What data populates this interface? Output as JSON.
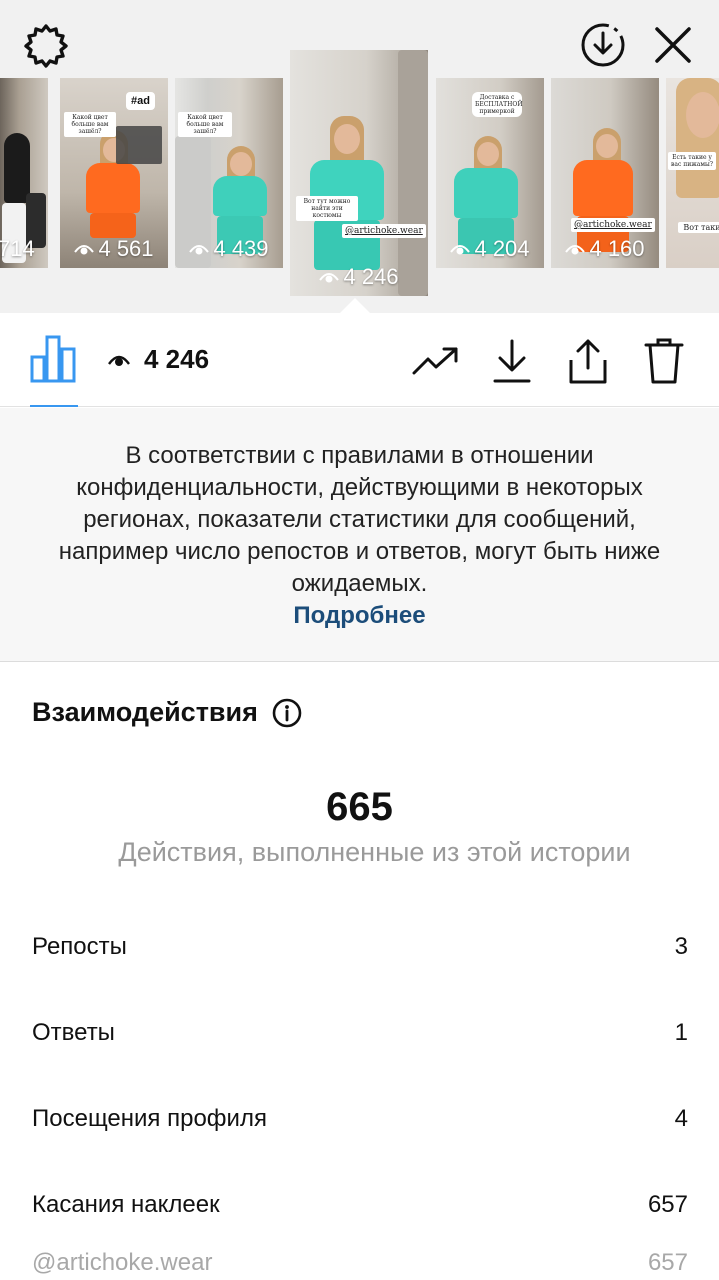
{
  "stories": [
    {
      "views": "714"
    },
    {
      "views": "4 561",
      "tag": "#ad",
      "note": "Какой цвет больше вам зашёл?"
    },
    {
      "views": "4 439",
      "note": "Какой цвет больше вам зашёл?"
    },
    {
      "views": "4 246",
      "note": "Вот тут можно найти эти костюмы",
      "mention": "@artichoke.wear"
    },
    {
      "views": "4 204",
      "note": "Доставка с БЕСПЛАТНОЙ примеркой"
    },
    {
      "views": "4 160",
      "mention": "@artichoke.wear"
    },
    {
      "note": "Есть такие у вас пижамы?",
      "note2": "Вот таки"
    }
  ],
  "action_bar": {
    "views": "4 246"
  },
  "notice": {
    "text": "В соответствии с правилами в отношении конфиденциальности, действующими в некоторых регионах, показатели статистики для сообщений, например число репостов и ответов, могут быть ниже ожидаемых.",
    "link": "Подробнее"
  },
  "interactions": {
    "title": "Взаимодействия",
    "total": "665",
    "caption": "Действия, выполненные из этой истории",
    "rows": [
      {
        "label": "Репосты",
        "value": "3"
      },
      {
        "label": "Ответы",
        "value": "1"
      },
      {
        "label": "Посещения профиля",
        "value": "4"
      },
      {
        "label": "Касания наклеек",
        "value": "657"
      },
      {
        "label": "@artichoke.wear",
        "value": "657"
      }
    ]
  },
  "colors": {
    "accent": "#3897f0",
    "link": "#1c4d7a",
    "muted": "#9a9a9a"
  }
}
